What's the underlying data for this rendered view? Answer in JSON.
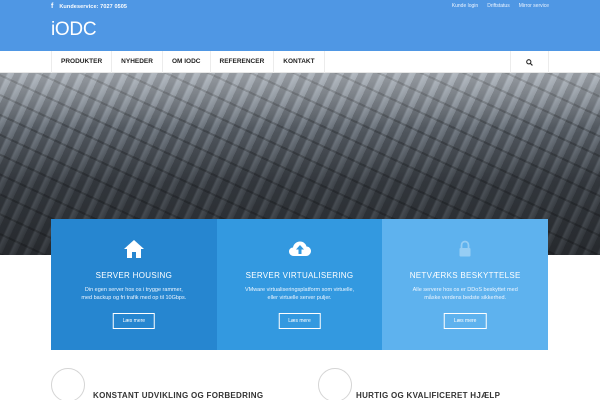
{
  "topbar": {
    "facebook_icon": "f",
    "phone_text": "Kundeservice: 7027 0505",
    "links": [
      "Kunde login",
      "Driftstatus",
      "Mirror service"
    ]
  },
  "logo": {
    "text": "iODC"
  },
  "nav": {
    "items": [
      "PRODUKTER",
      "NYHEDER",
      "OM IODC",
      "REFERENCER",
      "KONTAKT"
    ],
    "search_icon": "search-icon"
  },
  "services": [
    {
      "icon": "home-icon",
      "title": "SERVER HOUSING",
      "desc1": "Din egen server hos os i trygge rammer,",
      "desc2": "med backup og fri trafik med op til 10Gbps.",
      "button": "Læs mere"
    },
    {
      "icon": "cloud-upload-icon",
      "title": "SERVER VIRTUALISERING",
      "desc1": "VMware virtualiseringsplatform som virtuelle,",
      "desc2": "eller virtuelle server puljer.",
      "button": "Læs mere"
    },
    {
      "icon": "lock-icon",
      "title": "NETVÆRKS BESKYTTELSE",
      "desc1": "Alle servere hos os er DDoS beskyttet med",
      "desc2": "måske verdens bedste sikkerhed.",
      "button": "Læs mere"
    }
  ],
  "features": [
    {
      "title": "KONSTANT UDVIKLING OG FORBEDRING"
    },
    {
      "title": "HURTIG OG KVALIFICERET HJÆLP"
    }
  ],
  "colors": {
    "header_blue": "#4f97e4",
    "box1": "#2686d0",
    "box2": "#3399e0",
    "box3": "#5eb2ee"
  }
}
